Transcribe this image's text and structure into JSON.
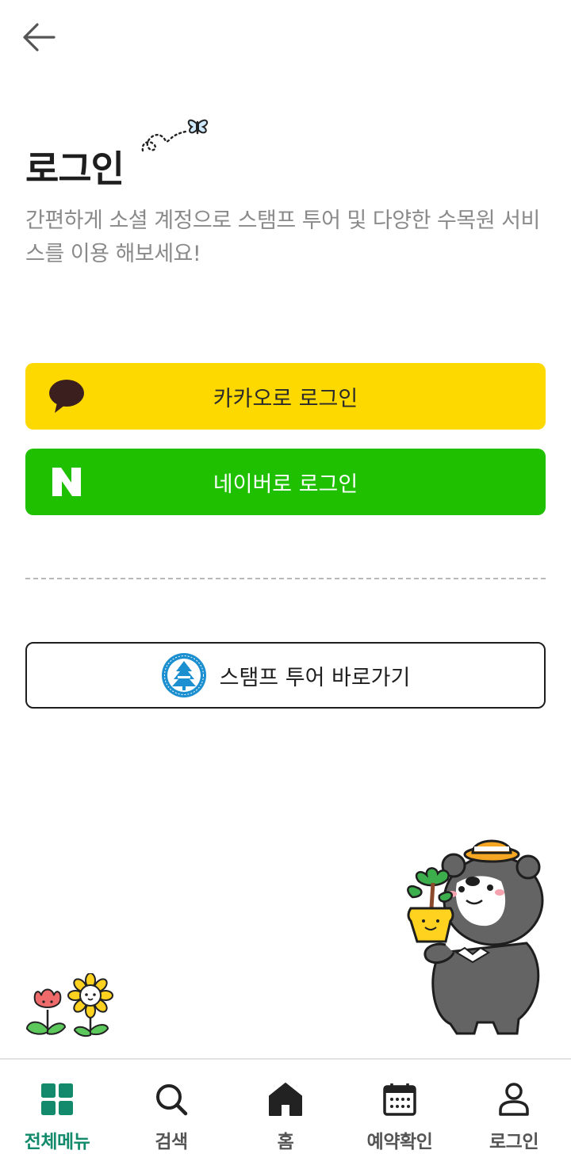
{
  "header": {
    "back_icon": "arrow-left-icon"
  },
  "login": {
    "title": "로그인",
    "subtitle": "간편하게 소셜 계정으로 스탬프 투어 및 다양한 수목원 서비스를 이용 해보세요!"
  },
  "buttons": {
    "kakao_label": "카카오로 로그인",
    "kakao_icon": "speech-bubble-icon",
    "kakao_color": "#fdd900",
    "naver_label": "네이버로 로그인",
    "naver_icon": "naver-n-icon",
    "naver_color": "#1ec000",
    "stamp_label": "스탬프 투어 바로가기",
    "stamp_icon": "arboretum-logo-icon"
  },
  "nav": {
    "active_color": "#128a6b",
    "items": [
      {
        "label": "전체메뉴",
        "icon": "grid-icon",
        "active": true
      },
      {
        "label": "검색",
        "icon": "search-icon",
        "active": false
      },
      {
        "label": "홈",
        "icon": "home-icon",
        "active": false
      },
      {
        "label": "예약확인",
        "icon": "calendar-icon",
        "active": false
      },
      {
        "label": "로그인",
        "icon": "user-icon",
        "active": false
      }
    ]
  }
}
